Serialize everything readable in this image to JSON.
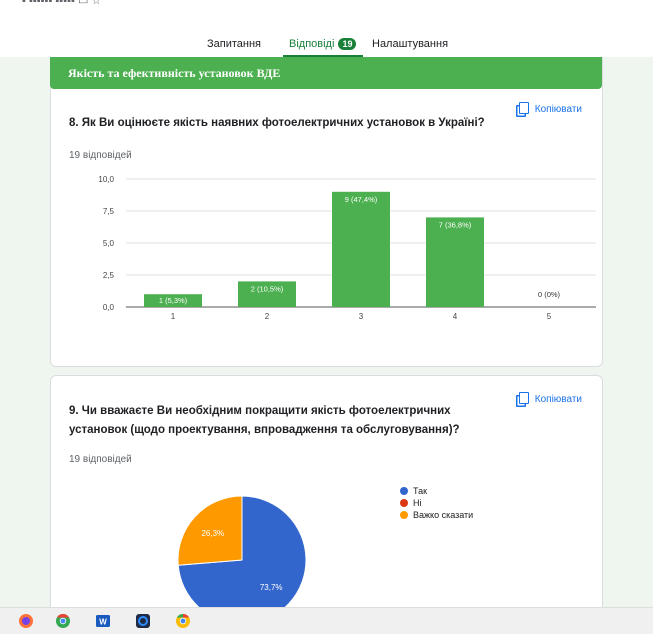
{
  "tabs": [
    {
      "label": "Запитання"
    },
    {
      "label": "Відповіді",
      "badge": "19",
      "active": true
    },
    {
      "label": "Налаштування"
    }
  ],
  "section_title": "Якість та ефективність установок ВДЕ",
  "q8": {
    "title": "8. Як Ви оцінюєте якість наявних фотоелектричних установок в Україні?",
    "count": "19 відповідей",
    "copy": "Копіювати"
  },
  "q9": {
    "title_line1": "9. Чи вважаєте Ви необхідним покращити якість фотоелектричних",
    "title_line2": "установок (щодо проектування, впровадження та обслуговування)?",
    "count": "19 відповідей",
    "copy": "Копіювати"
  },
  "chart_data": [
    {
      "type": "bar",
      "categories": [
        "1",
        "2",
        "3",
        "4",
        "5"
      ],
      "values": [
        1,
        2,
        9,
        7,
        0
      ],
      "data_labels": [
        "1 (5,3%)",
        "2 (10,5%)",
        "9 (47,4%)",
        "7 (36,8%)",
        "0 (0%)"
      ],
      "y_ticks": [
        "0,0",
        "2,5",
        "5,0",
        "7,5",
        "10,0"
      ],
      "ylim": [
        0,
        10
      ],
      "grid": true,
      "color": "#4caf50"
    },
    {
      "type": "pie",
      "labels": [
        "Так",
        "Ні",
        "Важко сказати"
      ],
      "values": [
        73.7,
        0,
        26.3
      ],
      "data_labels": [
        "73,7%",
        "",
        "26,3%"
      ],
      "colors": [
        "#3366cc",
        "#dc3912",
        "#ff9900"
      ],
      "legend": "right"
    }
  ],
  "taskbar": [
    "firefox-icon",
    "chrome-icon",
    "word-icon",
    "zoom-icon",
    "chrome-alt-icon"
  ]
}
